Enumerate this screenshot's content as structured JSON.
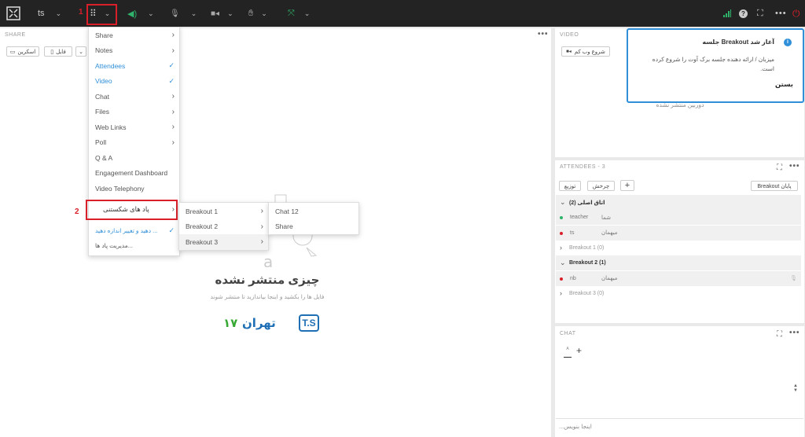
{
  "topbar": {
    "room_label": "ts",
    "annotation_1": "1",
    "annotation_2": "2",
    "colors": {
      "mic_active": "#2fb36b",
      "signal": "#2fb36b",
      "power": "#d9202a"
    }
  },
  "share_panel": {
    "header": "SHARE",
    "screen_button": "اسکرین",
    "file_button": "فایل",
    "empty_title": "چیزی منتشر نشده",
    "empty_subtitle": "فایل ها را بکشید و اینجا بیاندازید تا منتشر شوند",
    "logo_text": "تهران",
    "logo_number": "۱۷",
    "logo_letters": "T.S"
  },
  "pods_menu": {
    "items": [
      {
        "label": "Share",
        "arrow": true,
        "check": false,
        "active": false
      },
      {
        "label": "Notes",
        "arrow": true,
        "check": false,
        "active": false
      },
      {
        "label": "Attendees",
        "arrow": false,
        "check": true,
        "active": true
      },
      {
        "label": "Video",
        "arrow": false,
        "check": true,
        "active": true
      },
      {
        "label": "Chat",
        "arrow": true,
        "check": false,
        "active": false
      },
      {
        "label": "Files",
        "arrow": true,
        "check": false,
        "active": false
      },
      {
        "label": "Web Links",
        "arrow": true,
        "check": false,
        "active": false
      },
      {
        "label": "Poll",
        "arrow": true,
        "check": false,
        "active": false
      },
      {
        "label": "Q & A",
        "arrow": false,
        "check": false,
        "active": false
      },
      {
        "label": "Engagement Dashboard",
        "arrow": false,
        "check": false,
        "active": false
      },
      {
        "label": "Video Telephony",
        "arrow": false,
        "check": false,
        "active": false
      }
    ],
    "breakout_pods": "پاد های شکستنی",
    "resize_item": "... دهید و تغییر اندازه دهید",
    "manage_pods": "...مدیریت پاد ها"
  },
  "breakout_submenu": {
    "items": [
      "Breakout 1",
      "Breakout 2",
      "Breakout 3"
    ]
  },
  "breakout3_submenu": {
    "items": [
      "Chat 12",
      "Share"
    ]
  },
  "video_panel": {
    "header": "VIDEO",
    "start_webcam": "شروع وب کم",
    "no_camera": "دوربین منتشر نشده"
  },
  "toast": {
    "title": "آغاز شد Breakout جلسه",
    "body": "میزبان / ارائه دهنده جلسه برک آوت را شروع کرده است.",
    "close": "بستن"
  },
  "attendees": {
    "header": "ATTENDEES",
    "count": "3",
    "end_breakout": "Breakout پایان",
    "rotate": "چرخش",
    "distribute": "توزیع",
    "add": "+",
    "rows": [
      {
        "label": "اتاق اصلی (2)",
        "type": "group",
        "expanded": true
      },
      {
        "name": "teacher",
        "role": "شما",
        "status": "green",
        "type": "user"
      },
      {
        "name": "ts",
        "role": "میهمان",
        "status": "red",
        "type": "user"
      },
      {
        "label": "Breakout 1 (0)",
        "type": "group",
        "expanded": false
      },
      {
        "label": "Breakout 2 (1)",
        "type": "group",
        "expanded": true
      },
      {
        "name": "nb",
        "role": "میهمان",
        "status": "red",
        "type": "user"
      },
      {
        "label": "Breakout 3 (0)",
        "type": "group",
        "expanded": false
      }
    ]
  },
  "chat": {
    "header": "CHAT",
    "add": "+",
    "tab_label": "A",
    "input_placeholder": "...اینجا بنویس"
  }
}
